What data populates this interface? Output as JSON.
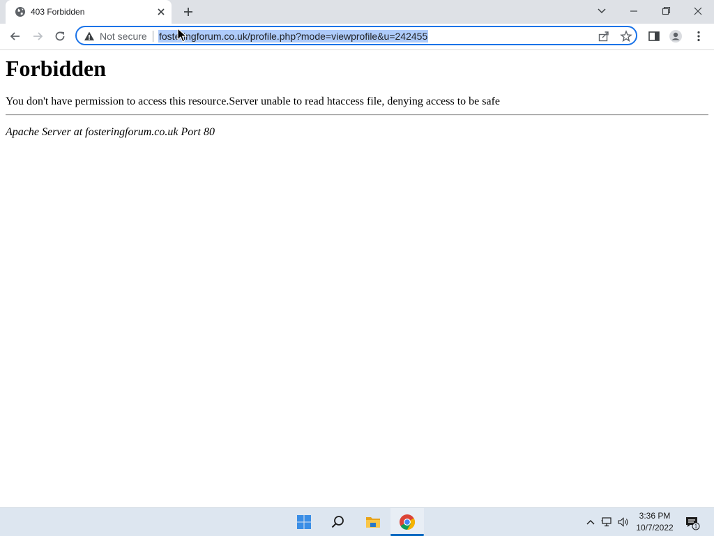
{
  "tab": {
    "title": "403 Forbidden"
  },
  "omnibox": {
    "security_label": "Not secure",
    "url": "fosteringforum.co.uk/profile.php?mode=viewprofile&u=242455"
  },
  "page": {
    "heading": "Forbidden",
    "message": "You don't have permission to access this resource.Server unable to read htaccess file, denying access to be safe",
    "footer": "Apache Server at fosteringforum.co.uk Port 80"
  },
  "taskbar": {
    "time": "3:36 PM",
    "date": "10/7/2022",
    "notification_count": "1"
  },
  "colors": {
    "accent": "#1a73e8",
    "url_selection": "#aecbfa",
    "taskbar": "#dde6f0"
  }
}
